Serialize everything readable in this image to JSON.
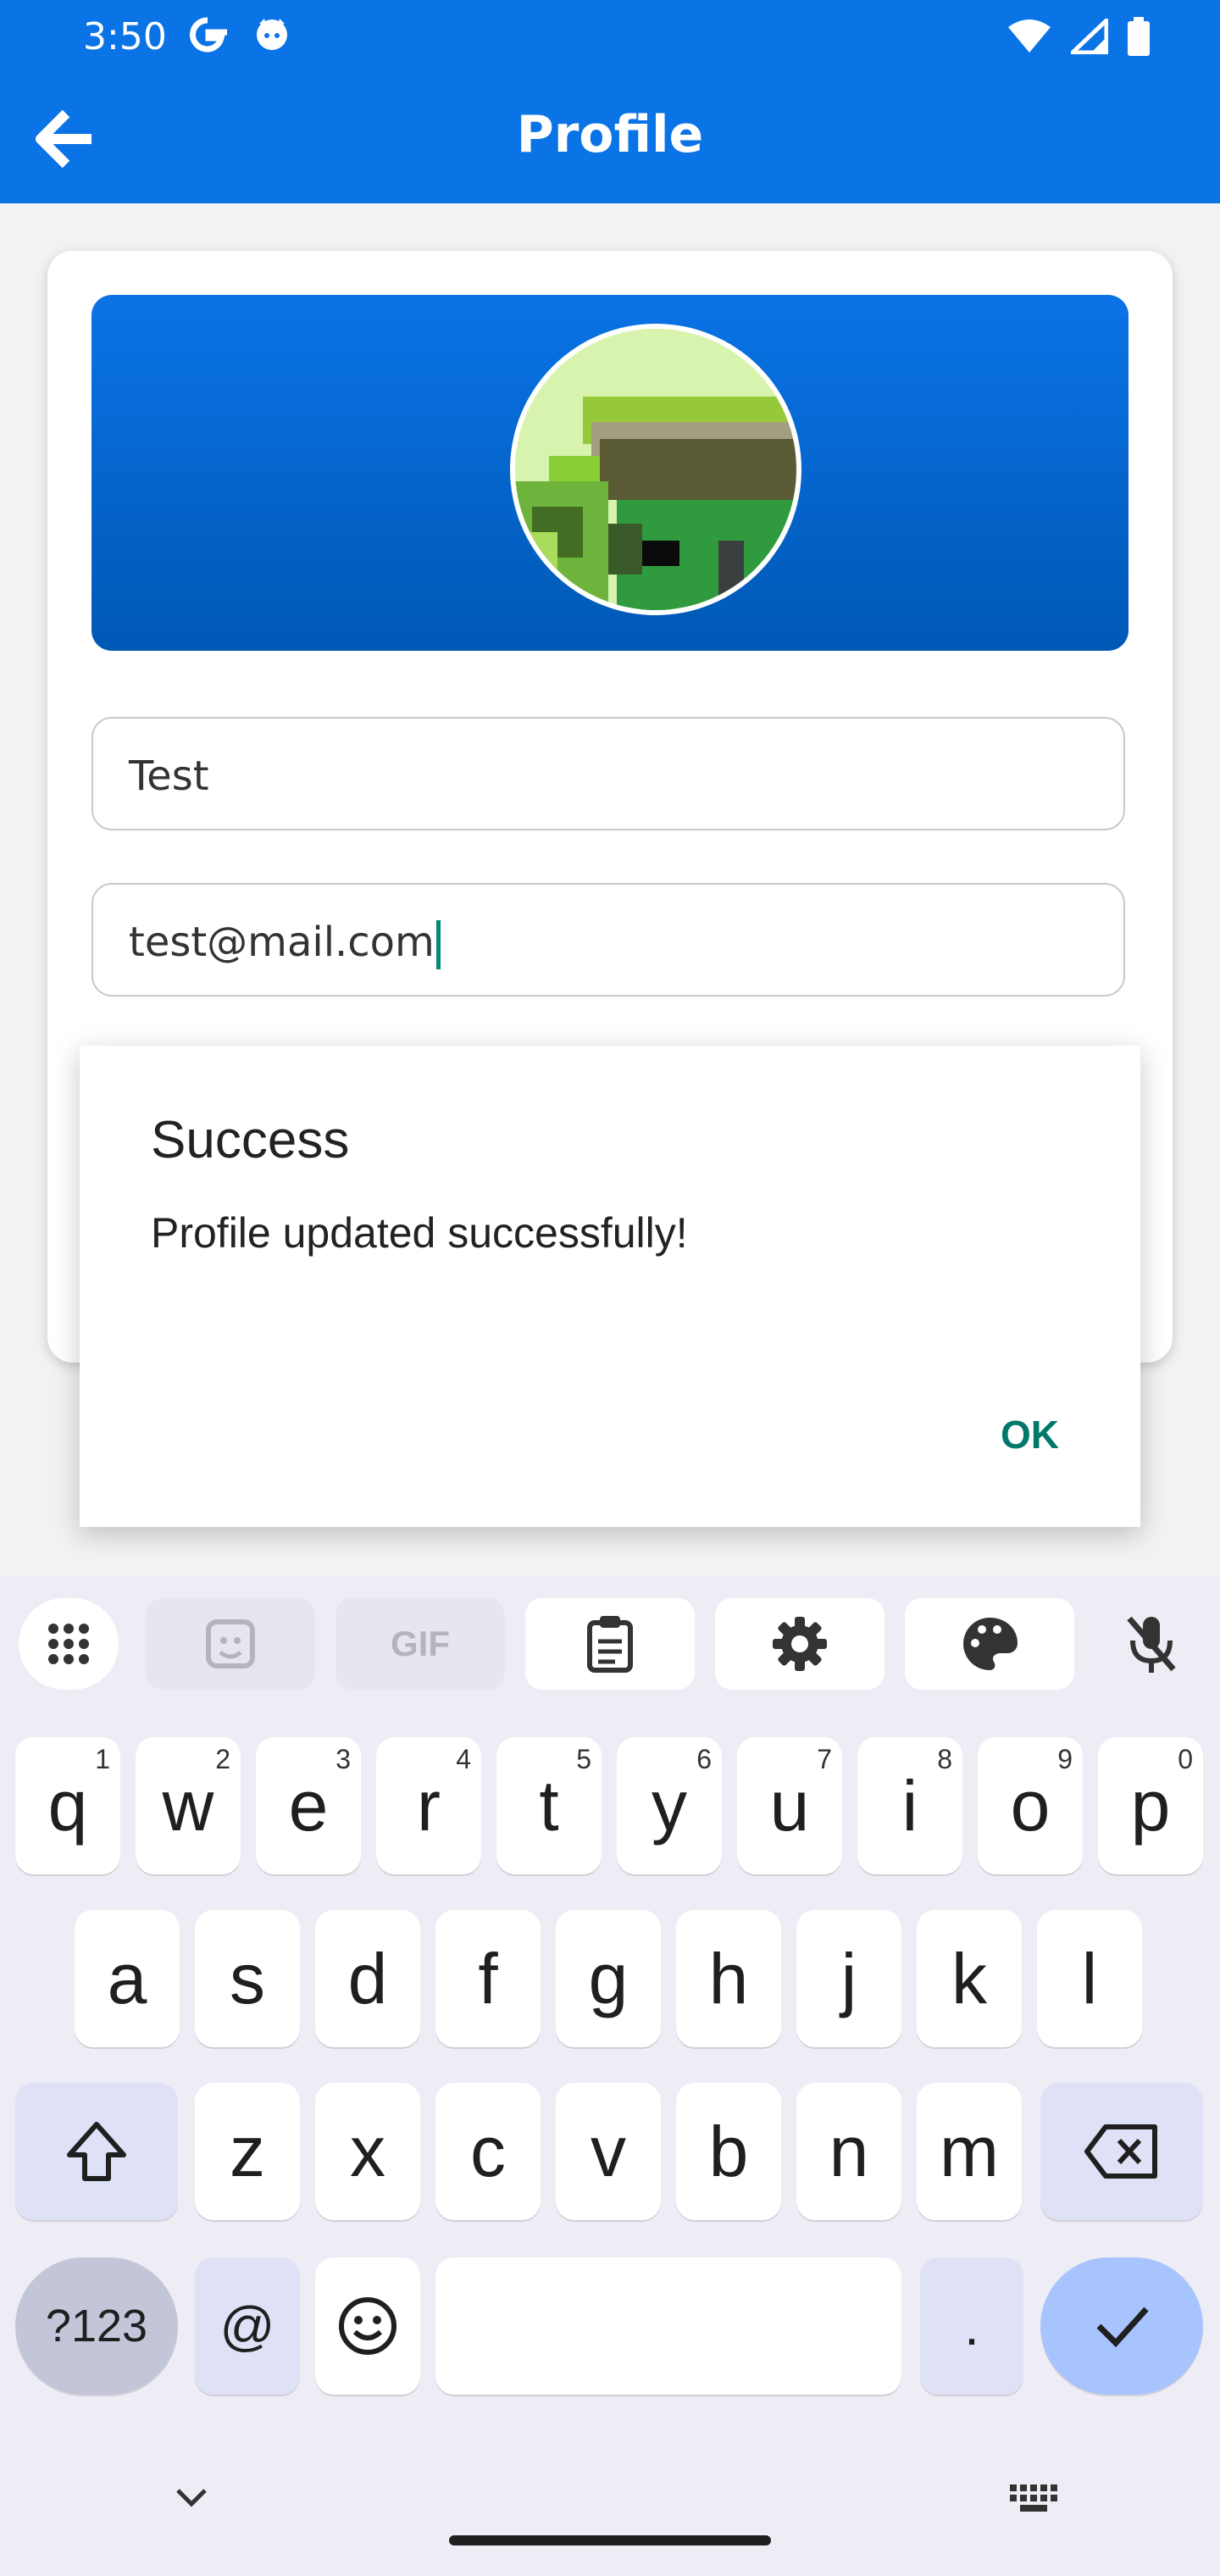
{
  "status_bar": {
    "time": "3:50",
    "left_icons": [
      "google-icon",
      "cat-notification-icon"
    ],
    "right_icons": [
      "wifi-icon",
      "cell-signal-icon",
      "battery-icon"
    ]
  },
  "app_bar": {
    "title": "Profile",
    "back_icon": "arrow-left-icon"
  },
  "profile": {
    "name_value": "Test",
    "email_value": "test@mail.com",
    "avatar_icon": "pixel-art-avatar"
  },
  "dialog": {
    "title": "Success",
    "message": "Profile updated successfully!",
    "ok_label": "OK"
  },
  "keyboard": {
    "suggestion_icons": [
      "apps-grid-icon",
      "sticker-icon",
      "gif-icon",
      "clipboard-icon",
      "settings-icon",
      "palette-icon",
      "mic-off-icon"
    ],
    "gif_label": "GIF",
    "row1": [
      {
        "k": "q",
        "n": "1"
      },
      {
        "k": "w",
        "n": "2"
      },
      {
        "k": "e",
        "n": "3"
      },
      {
        "k": "r",
        "n": "4"
      },
      {
        "k": "t",
        "n": "5"
      },
      {
        "k": "y",
        "n": "6"
      },
      {
        "k": "u",
        "n": "7"
      },
      {
        "k": "i",
        "n": "8"
      },
      {
        "k": "o",
        "n": "9"
      },
      {
        "k": "p",
        "n": "0"
      }
    ],
    "row2": [
      "a",
      "s",
      "d",
      "f",
      "g",
      "h",
      "j",
      "k",
      "l"
    ],
    "row3": [
      "z",
      "x",
      "c",
      "v",
      "b",
      "n",
      "m"
    ],
    "symbols_label": "?123",
    "at_label": "@",
    "period_label": ".",
    "nav_icons": [
      "chevron-down-icon",
      "keyboard-switch-icon"
    ]
  },
  "colors": {
    "primary": "#0a73e6",
    "accent": "#00796b",
    "keyboard_bg": "#eeedf5"
  }
}
